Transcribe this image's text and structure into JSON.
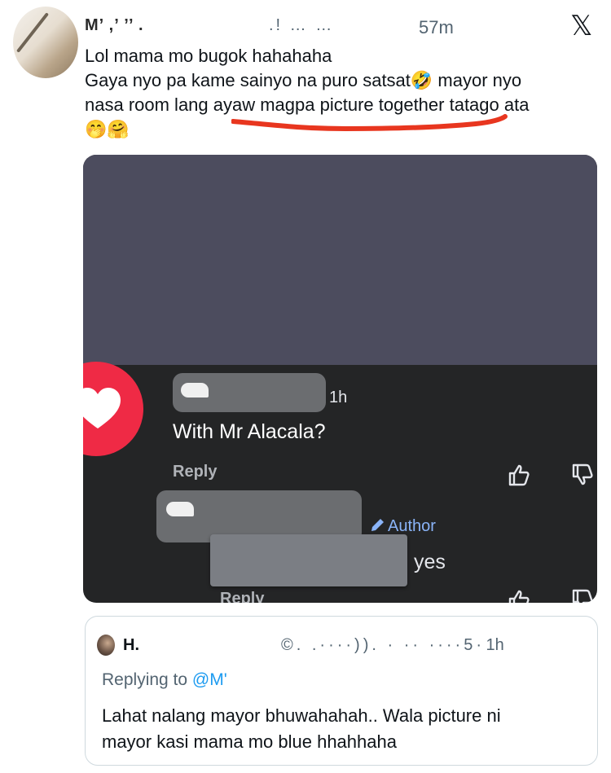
{
  "header": {
    "name": "M’ ,’ ’’ .",
    "handle": ".! … …",
    "time": "57m",
    "x_logo": "𝕏"
  },
  "tweet": {
    "lines": [
      "Lol mama mo bugok hahahaha",
      "Gaya nyo pa kame sainyo na puro satsat🤣 mayor nyo",
      "nasa room lang ayaw magpa picture together tatago ata",
      "🤭🤗"
    ]
  },
  "screenshot": {
    "comment1": {
      "time": "1h",
      "text": "With Mr Alacala?",
      "reply_label": "Reply"
    },
    "comment2": {
      "author_badge": "Author",
      "text": "yes",
      "reply_label": "Reply"
    }
  },
  "quote": {
    "name": "H.",
    "meta": "©. .····)). · ·· ····5",
    "time": "· 1h",
    "replying_prefix": "Replying to ",
    "replying_handle": "@M'",
    "lines": [
      "Lahat nalang mayor bhuwahahah.. Wala picture ni",
      "mayor kasi mama mo blue hhahhaha"
    ]
  },
  "colors": {
    "accent_link": "#1d9bf0",
    "underline_marker": "#e8361f",
    "reaction_heart": "#ef2a45",
    "author_badge": "#8ab4f8"
  },
  "icons": [
    "x-logo-icon",
    "heart-icon",
    "thumbs-up-icon",
    "thumbs-down-icon",
    "pencil-icon"
  ]
}
